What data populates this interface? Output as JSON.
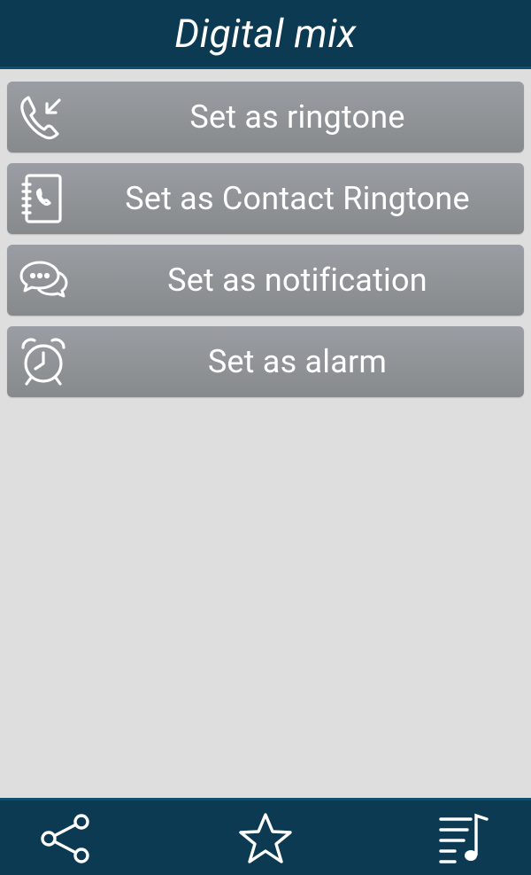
{
  "header": {
    "title": "Digital mix"
  },
  "actions": [
    {
      "label": "Set as ringtone",
      "icon": "incoming-call-icon"
    },
    {
      "label": "Set as Contact Ringtone",
      "icon": "contact-book-icon"
    },
    {
      "label": "Set as notification",
      "icon": "chat-bubbles-icon"
    },
    {
      "label": "Set as alarm",
      "icon": "alarm-clock-icon"
    }
  ],
  "bottom_bar": {
    "items": [
      {
        "icon": "share-icon"
      },
      {
        "icon": "star-icon"
      },
      {
        "icon": "playlist-icon"
      }
    ]
  },
  "colors": {
    "header_bg": "#0b3a52",
    "button_bg": "#8f9396",
    "page_bg": "#dedede",
    "text": "#ffffff"
  }
}
